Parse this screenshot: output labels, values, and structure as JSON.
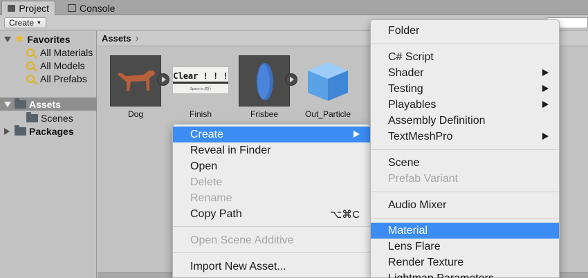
{
  "tabs": [
    {
      "label": "Project",
      "icon": "folder-icon"
    },
    {
      "label": "Console",
      "icon": "console-icon"
    }
  ],
  "toolbar": {
    "create_label": "Create"
  },
  "tree": {
    "favorites": {
      "label": "Favorites",
      "items": [
        "All Materials",
        "All Models",
        "All Prefabs"
      ]
    },
    "assets": {
      "label": "Assets",
      "children": [
        "Scenes"
      ]
    },
    "packages": {
      "label": "Packages"
    }
  },
  "breadcrumb": {
    "label": "Assets"
  },
  "assets": [
    {
      "name": "Dog",
      "icon": "dog-model-icon"
    },
    {
      "name": "Finish",
      "icon": "finish-prefab-icon",
      "preview_text": "Clear ! ! !",
      "preview_sub": "Space to 続行"
    },
    {
      "name": "Frisbee",
      "icon": "frisbee-model-icon"
    },
    {
      "name": "Out_Particle",
      "icon": "cube-prefab-icon"
    }
  ],
  "context_menu": {
    "items": [
      {
        "label": "Create",
        "highlighted": true,
        "submenu": true
      },
      {
        "label": "Reveal in Finder"
      },
      {
        "label": "Open"
      },
      {
        "label": "Delete",
        "disabled": true
      },
      {
        "label": "Rename",
        "disabled": true
      },
      {
        "label": "Copy Path",
        "shortcut": "⌥⌘C"
      },
      {
        "label": "Open Scene Additive",
        "disabled": true
      },
      {
        "label": "Import New Asset..."
      }
    ]
  },
  "create_submenu": {
    "items": [
      {
        "label": "Folder"
      },
      {
        "label": "C# Script"
      },
      {
        "label": "Shader",
        "submenu": true
      },
      {
        "label": "Testing",
        "submenu": true
      },
      {
        "label": "Playables",
        "submenu": true
      },
      {
        "label": "Assembly Definition"
      },
      {
        "label": "TextMeshPro",
        "submenu": true
      },
      {
        "label": "Scene"
      },
      {
        "label": "Prefab Variant",
        "disabled": true
      },
      {
        "label": "Audio Mixer"
      },
      {
        "label": "Material",
        "highlighted": true
      },
      {
        "label": "Lens Flare"
      },
      {
        "label": "Render Texture"
      },
      {
        "label": "Lightmap Parameters"
      }
    ]
  },
  "colors": {
    "highlight": "#3b8cf3",
    "selected_tree": "#8e8e8e",
    "menu_bg": "#ececec"
  }
}
